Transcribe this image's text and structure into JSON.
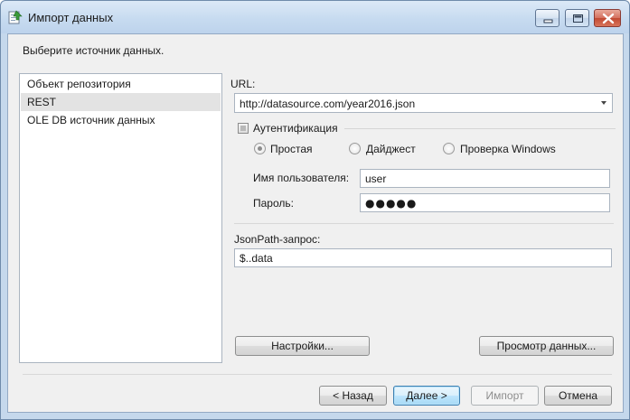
{
  "window": {
    "title": "Импорт данных"
  },
  "instruction": "Выберите источник данных.",
  "sources": {
    "items": [
      {
        "label": "Объект репозитория"
      },
      {
        "label": "REST"
      },
      {
        "label": "OLE DB источник данных"
      }
    ],
    "selected": "REST"
  },
  "rest": {
    "url_label": "URL:",
    "url_value": "http://datasource.com/year2016.json",
    "auth_label": "Аутентификация",
    "auth_checked": false,
    "auth_options": [
      {
        "label": "Простая",
        "checked": true
      },
      {
        "label": "Дайджест",
        "checked": false
      },
      {
        "label": "Проверка Windows",
        "checked": false
      }
    ],
    "username_label": "Имя пользователя:",
    "username_value": "user",
    "password_label": "Пароль:",
    "password_value": "●●●●●",
    "jsonpath_label": "JsonPath-запрос:",
    "jsonpath_value": "$..data",
    "settings_button": "Настройки...",
    "preview_button": "Просмотр данных..."
  },
  "footer": {
    "back": "< Назад",
    "next": "Далее >",
    "import": "Импорт",
    "cancel": "Отмена"
  }
}
